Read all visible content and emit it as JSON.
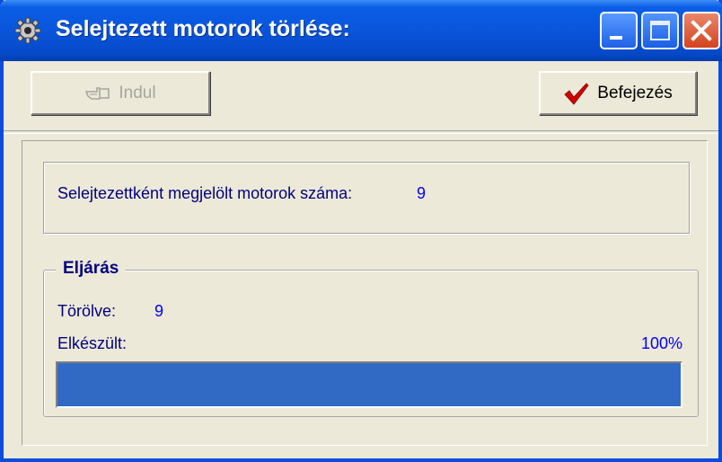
{
  "window": {
    "title": "Selejtezett motorok törlése:",
    "icon": "gear-icon",
    "controls": [
      "minimize",
      "maximize",
      "close"
    ]
  },
  "toolbar": {
    "start_label": "Indul",
    "start_icon": "hand-pointer-icon",
    "start_enabled": false,
    "finish_label": "Befejezés",
    "finish_icon": "checkmark-icon"
  },
  "summary": {
    "marked_label": "Selejtezettként megjelölt motorok száma:",
    "marked_value": "9"
  },
  "process": {
    "title": "Eljárás",
    "deleted_label": "Törölve:",
    "deleted_value": "9",
    "done_label": "Elkészült:",
    "done_value": "100%",
    "progress_fraction": 1.0
  },
  "colors": {
    "titlebar": "#0a55dc",
    "face": "#ece9d8",
    "progress_fill": "#316ac5",
    "value_text": "#0000ff",
    "label_text": "#000080",
    "checkmark": "#d40000"
  }
}
